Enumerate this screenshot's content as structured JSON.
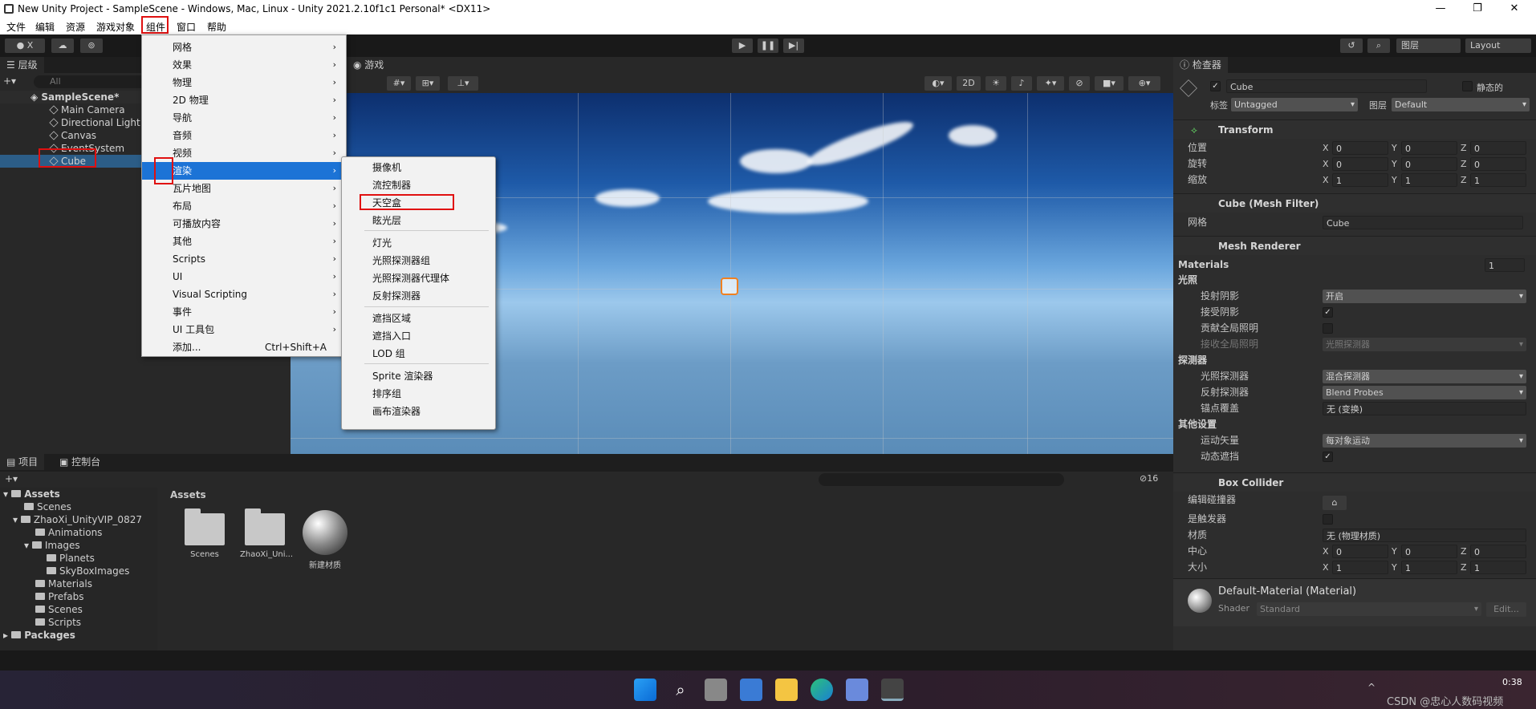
{
  "window": {
    "title": "New Unity Project - SampleScene - Windows, Mac, Linux - Unity 2021.2.10f1c1 Personal* <DX11>",
    "minimize": "—",
    "maximize": "❐",
    "close": "✕"
  },
  "menubar": [
    "文件",
    "编辑",
    "资源",
    "游戏对象",
    "组件",
    "窗口",
    "帮助"
  ],
  "toolbar": {
    "account": "X",
    "layers": "图层",
    "layout": "Layout"
  },
  "hierarchy": {
    "tab": "层级",
    "search_placeholder": "All",
    "scene": "SampleScene*",
    "items": [
      "Main Camera",
      "Directional Light",
      "Canvas",
      "EventSystem",
      "Cube"
    ]
  },
  "game": {
    "tab": "游戏",
    "mode2d": "2D"
  },
  "component_menu": {
    "items": [
      {
        "label": "网格",
        "arrow": "›"
      },
      {
        "label": "效果",
        "arrow": "›"
      },
      {
        "label": "物理",
        "arrow": "›"
      },
      {
        "label": "2D 物理",
        "arrow": "›"
      },
      {
        "label": "导航",
        "arrow": "›"
      },
      {
        "label": "音频",
        "arrow": "›"
      },
      {
        "label": "视频",
        "arrow": "›"
      },
      {
        "label": "渲染",
        "arrow": "›"
      },
      {
        "label": "瓦片地图",
        "arrow": "›"
      },
      {
        "label": "布局",
        "arrow": "›"
      },
      {
        "label": "可播放内容",
        "arrow": "›"
      },
      {
        "label": "其他",
        "arrow": "›"
      },
      {
        "label": "Scripts",
        "arrow": "›"
      },
      {
        "label": "UI",
        "arrow": "›"
      },
      {
        "label": "Visual Scripting",
        "arrow": "›"
      },
      {
        "label": "事件",
        "arrow": "›"
      },
      {
        "label": "UI 工具包",
        "arrow": "›"
      },
      {
        "label": "添加...",
        "shortcut": "Ctrl+Shift+A"
      }
    ]
  },
  "render_menu": {
    "items": [
      "摄像机",
      "流控制器",
      "天空盒",
      "眩光层",
      "灯光",
      "光照探测器组",
      "光照探测器代理体",
      "反射探测器",
      "遮挡区域",
      "遮挡入口",
      "LOD 组",
      "Sprite 渲染器",
      "排序组",
      "画布渲染器"
    ]
  },
  "inspector": {
    "tab": "检查器",
    "name": "Cube",
    "static": "静态的",
    "tag_label": "标签",
    "tag": "Untagged",
    "layer_label": "图层",
    "layer": "Default",
    "transform": {
      "title": "Transform",
      "pos": "位置",
      "rot": "旋转",
      "scale": "缩放",
      "x": "X",
      "y": "Y",
      "z": "Z",
      "p": [
        "0",
        "0",
        "0"
      ],
      "r": [
        "0",
        "0",
        "0"
      ],
      "s": [
        "1",
        "1",
        "1"
      ]
    },
    "meshfilter": {
      "title": "Cube (Mesh Filter)",
      "mesh_label": "网格",
      "mesh": "Cube"
    },
    "renderer": {
      "title": "Mesh Renderer",
      "materials": "Materials",
      "mat_count": "1",
      "lighting": "光照",
      "cast": "投射阴影",
      "cast_val": "开启",
      "receive": "接受阴影",
      "gi": "贡献全局照明",
      "recv_gi": "接收全局照明",
      "recv_gi_val": "光照探测器",
      "probes": "探测器",
      "light_probes": "光照探测器",
      "light_probes_val": "混合探测器",
      "refl": "反射探测器",
      "refl_val": "Blend Probes",
      "anchor": "锚点覆盖",
      "anchor_val": "无 (变换)",
      "other": "其他设置",
      "motion": "运动矢量",
      "motion_val": "每对象运动",
      "dyn": "动态遮挡"
    },
    "collider": {
      "title": "Box Collider",
      "edit": "编辑碰撞器",
      "trigger": "是触发器",
      "material": "材质",
      "material_val": "无 (物理材质)",
      "center": "中心",
      "size": "大小",
      "c": [
        "0",
        "0",
        "0"
      ],
      "sz": [
        "1",
        "1",
        "1"
      ]
    },
    "material": {
      "name": "Default-Material (Material)",
      "shader_label": "Shader",
      "shader": "Standard",
      "edit": "Edit..."
    },
    "check": "✓",
    "help": "?"
  },
  "project": {
    "tab1": "项目",
    "tab2": "控制台",
    "breadcrumb": "Assets",
    "count": "16",
    "tree": [
      "Assets",
      "Scenes",
      "ZhaoXi_UnityVIP_0827",
      "Animations",
      "Images",
      "Planets",
      "SkyBoxImages",
      "Materials",
      "Prefabs",
      "Scenes",
      "Scripts",
      "Packages"
    ],
    "assets": [
      "Scenes",
      "ZhaoXi_Uni...",
      "新建材质"
    ]
  },
  "taskbar": {
    "time": "0:38",
    "date": "",
    "watermark": "CSDN @忠心人数码视频",
    "tray": "^"
  },
  "colors": {
    "accent": "#1c73d6",
    "highlight_red": "#e01010"
  }
}
